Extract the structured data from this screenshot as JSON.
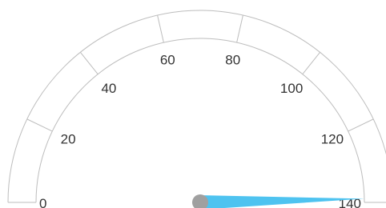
{
  "chart_data": {
    "type": "gauge",
    "min": 0,
    "max": 140,
    "value": 139,
    "tick_labels": [
      "0",
      "20",
      "40",
      "60",
      "80",
      "100",
      "120",
      "140"
    ],
    "grid": true,
    "colors": {
      "needle": "#4ec3f0",
      "pivot": "#a0a0a0",
      "band_stroke": "#bdbdbd",
      "label": "#333333"
    }
  }
}
